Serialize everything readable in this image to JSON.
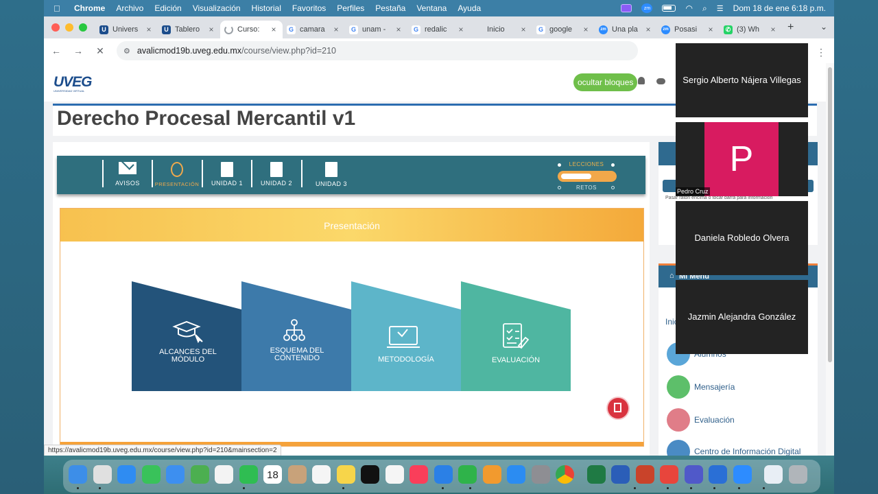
{
  "menubar": {
    "apple": "",
    "items": [
      "Chrome",
      "Archivo",
      "Edición",
      "Visualización",
      "Historial",
      "Favoritos",
      "Perfiles",
      "Pestaña",
      "Ventana",
      "Ayuda"
    ],
    "clock": "Dom 18 de ene  6:18 p.m."
  },
  "browser": {
    "tabs": [
      {
        "title": "Univers",
        "favicon": "uveg-icon",
        "favcolor": "#1c4d8c",
        "favtext": "U"
      },
      {
        "title": "Tablero",
        "favicon": "uveg-icon",
        "favcolor": "#1c4d8c",
        "favtext": "U"
      },
      {
        "title": "Curso:",
        "favicon": "loading-icon",
        "favcolor": "#ffffff",
        "favtext": "",
        "active": true
      },
      {
        "title": "camara",
        "favicon": "google-icon",
        "favcolor": "#4285f4",
        "favtext": "G"
      },
      {
        "title": "unam -",
        "favicon": "google-icon",
        "favcolor": "#4285f4",
        "favtext": "G"
      },
      {
        "title": "redalic",
        "favicon": "google-icon",
        "favcolor": "#4285f4",
        "favtext": "G"
      },
      {
        "title": "Inicio",
        "favicon": "blank-icon",
        "favcolor": "#dee1e6",
        "favtext": ""
      },
      {
        "title": "google",
        "favicon": "google-icon",
        "favcolor": "#4285f4",
        "favtext": "G"
      },
      {
        "title": "Una pla",
        "favicon": "zoom-icon",
        "favcolor": "#2d8cff",
        "favtext": "zm"
      },
      {
        "title": "Posasi",
        "favicon": "zoom-icon",
        "favcolor": "#2d8cff",
        "favtext": "zm"
      },
      {
        "title": "(3) Wh",
        "favicon": "whatsapp-icon",
        "favcolor": "#25d366",
        "favtext": "✆"
      }
    ],
    "url_host": "avalicmod19b.uveg.edu.mx",
    "url_path": "/course/view.php?id=210",
    "status_url": "https://avalicmod19b.uveg.edu.mx/course/view.php?id=210&mainsection=2"
  },
  "site": {
    "logo": "UVEG",
    "logo_sub": "UNIVERSIDAD VIRTUAL",
    "hide_blocks": "ocultar bloques",
    "course_title": "Derecho Procesal Mercantil v1",
    "hint": "Pasar ratón encima o tocar barra para información"
  },
  "course_nav": {
    "items": [
      {
        "label": "AVISOS",
        "icon": "envelope-icon"
      },
      {
        "label": "PRESENTACIÓN",
        "icon": "person-icon"
      },
      {
        "label": "UNIDAD 1",
        "icon": "book-icon"
      },
      {
        "label": "UNIDAD 2",
        "icon": "book-icon"
      },
      {
        "label": "UNIDAD 3",
        "icon": "book-icon"
      }
    ],
    "lessons_label": "LECCIONES",
    "challenges_label": "RETOS"
  },
  "presentation": {
    "title": "Presentación",
    "cards": [
      {
        "label": "Alcances del módulo",
        "icon": "graduation-cap-icon",
        "color": "#23537a"
      },
      {
        "label": "Esquema del contenido",
        "icon": "hierarchy-icon",
        "color": "#3d7aaa"
      },
      {
        "label": "Metodología",
        "icon": "laptop-hand-icon",
        "color": "#5db5c9"
      },
      {
        "label": "Evaluación",
        "icon": "checklist-icon",
        "color": "#4fb6a1"
      }
    ]
  },
  "sidebar": {
    "menu_title": "Mi Menú",
    "menu_cut": "Inic",
    "items": [
      {
        "label": "Alumnos",
        "icon": "students-icon",
        "color": "#5aa6d8"
      },
      {
        "label": "Mensajería",
        "icon": "envelope-icon",
        "color": "#5dbf6a"
      },
      {
        "label": "Evaluación",
        "icon": "checklist-icon",
        "color": "#e07d88"
      },
      {
        "label": "Centro de Información Digital",
        "icon": "monitor-icon",
        "color": "#4a8bc4"
      }
    ]
  },
  "zoom": {
    "participants": [
      {
        "name": "Sergio Alberto Nájera Villegas"
      },
      {
        "name": "Pedro Cruz",
        "avatar": "P"
      },
      {
        "name": "Daniela Robledo Olvera"
      },
      {
        "name": "Jazmin Alejandra González"
      }
    ]
  },
  "dock": {
    "calendar_day": "18",
    "apps": [
      "finder-icon",
      "launchpad-icon",
      "safari-icon",
      "messages-icon",
      "mail-icon",
      "maps-icon",
      "photos-icon",
      "facetime-icon",
      "calendar-icon",
      "contacts-icon",
      "reminders-icon",
      "notes-icon",
      "appletv-icon",
      "freeform-icon",
      "music-icon",
      "keynote-icon",
      "numbers-icon",
      "pages-icon",
      "appstore-icon",
      "settings-icon",
      "chrome-icon",
      "excel-icon",
      "word-icon",
      "powerpoint-icon",
      "anydesk-icon",
      "teams-icon",
      "quicktime-icon",
      "zoom-icon",
      "preview-icon",
      "trash-icon"
    ]
  }
}
